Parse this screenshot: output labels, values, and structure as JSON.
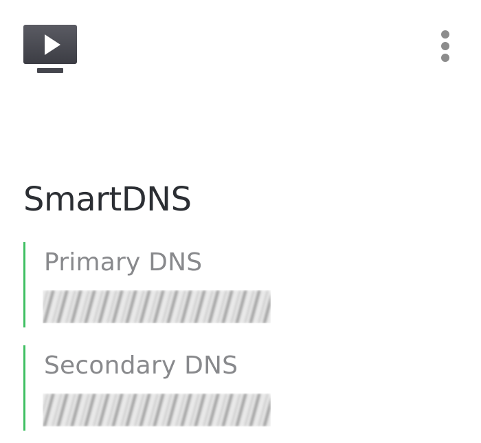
{
  "header": {
    "app_icon": "tv-play-icon",
    "menu_icon": "more-vertical-icon"
  },
  "main": {
    "title": "SmartDNS",
    "dns_entries": [
      {
        "label": "Primary DNS",
        "value_state": "redacted"
      },
      {
        "label": "Secondary DNS",
        "value_state": "redacted"
      }
    ]
  },
  "colors": {
    "accent": "#3fbf62",
    "title_text": "#2b2e33",
    "label_text": "#88898c",
    "icon_fill": "#45464d",
    "menu_dots": "#8c8c8c"
  }
}
